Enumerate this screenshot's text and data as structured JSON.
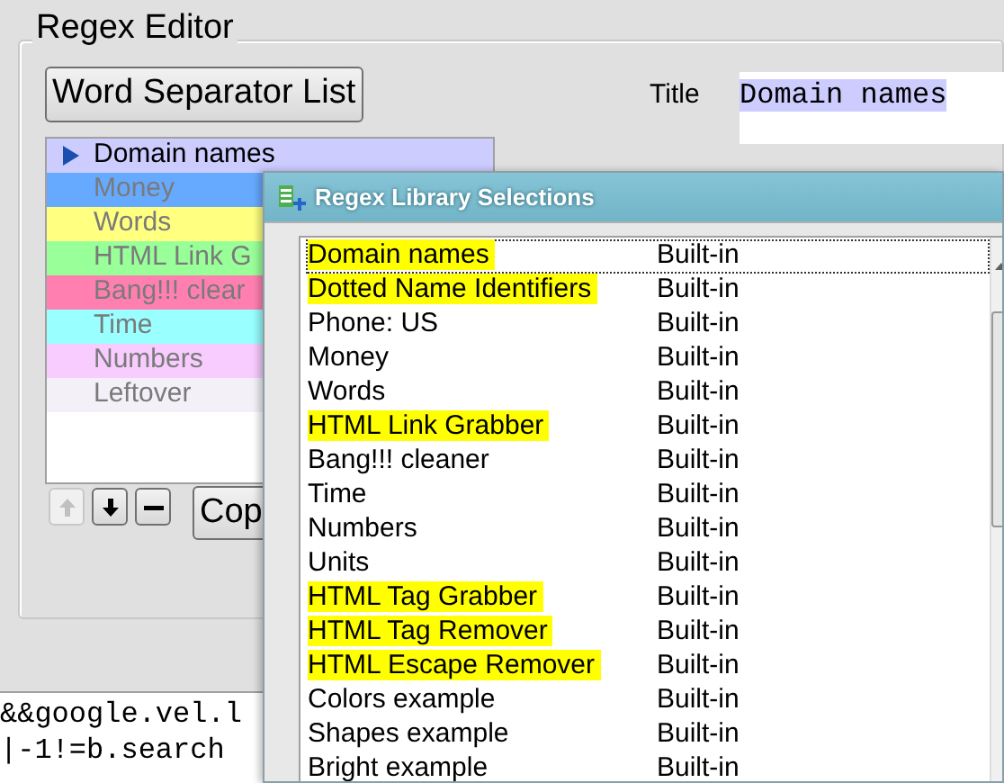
{
  "group_title": "Regex Editor",
  "word_separator_button": "Word Separator List",
  "title_label": "Title",
  "title_value": "Domain names",
  "regex_list": [
    {
      "label": "Domain names",
      "selected": true,
      "color": "#ccccff"
    },
    {
      "label": "Money",
      "selected": false,
      "color": "#66aaff"
    },
    {
      "label": "Words",
      "selected": false,
      "color": "#ffff80"
    },
    {
      "label": "HTML Link G",
      "selected": false,
      "color": "#99ff99"
    },
    {
      "label": "Bang!!! clear",
      "selected": false,
      "color": "#ff80b0"
    },
    {
      "label": "Time",
      "selected": false,
      "color": "#99ffff"
    },
    {
      "label": "Numbers",
      "selected": false,
      "color": "#f8ccff"
    },
    {
      "label": "Leftover",
      "selected": false,
      "color": "#f4f0f8"
    }
  ],
  "list_buttons": [
    {
      "kind": "up",
      "disabled": true
    },
    {
      "kind": "down",
      "disabled": false
    },
    {
      "kind": "remove",
      "disabled": false
    }
  ],
  "copy_button": "Cop",
  "code_lines": [
    "&&google.vel.l",
    "|-1!=b.search"
  ],
  "dialog": {
    "title": "Regex Library Selections",
    "rows": [
      {
        "name": "Domain names",
        "source": "Built-in",
        "highlighted": true,
        "selected": true
      },
      {
        "name": "Dotted Name Identifiers",
        "source": "Built-in",
        "highlighted": true,
        "selected": false
      },
      {
        "name": "Phone: US",
        "source": "Built-in",
        "highlighted": false,
        "selected": false
      },
      {
        "name": "Money",
        "source": "Built-in",
        "highlighted": false,
        "selected": false
      },
      {
        "name": "Words",
        "source": "Built-in",
        "highlighted": false,
        "selected": false
      },
      {
        "name": "HTML Link Grabber",
        "source": "Built-in",
        "highlighted": true,
        "selected": false
      },
      {
        "name": "Bang!!! cleaner",
        "source": "Built-in",
        "highlighted": false,
        "selected": false
      },
      {
        "name": "Time",
        "source": "Built-in",
        "highlighted": false,
        "selected": false
      },
      {
        "name": "Numbers",
        "source": "Built-in",
        "highlighted": false,
        "selected": false
      },
      {
        "name": "Units",
        "source": "Built-in",
        "highlighted": false,
        "selected": false
      },
      {
        "name": "HTML Tag Grabber",
        "source": "Built-in",
        "highlighted": true,
        "selected": false
      },
      {
        "name": "HTML Tag Remover",
        "source": "Built-in",
        "highlighted": true,
        "selected": false
      },
      {
        "name": "HTML Escape Remover",
        "source": "Built-in",
        "highlighted": true,
        "selected": false
      },
      {
        "name": "Colors example",
        "source": "Built-in",
        "highlighted": false,
        "selected": false
      },
      {
        "name": "Shapes example",
        "source": "Built-in",
        "highlighted": false,
        "selected": false
      },
      {
        "name": "Bright example",
        "source": "Built-in",
        "highlighted": false,
        "selected": false
      }
    ]
  }
}
